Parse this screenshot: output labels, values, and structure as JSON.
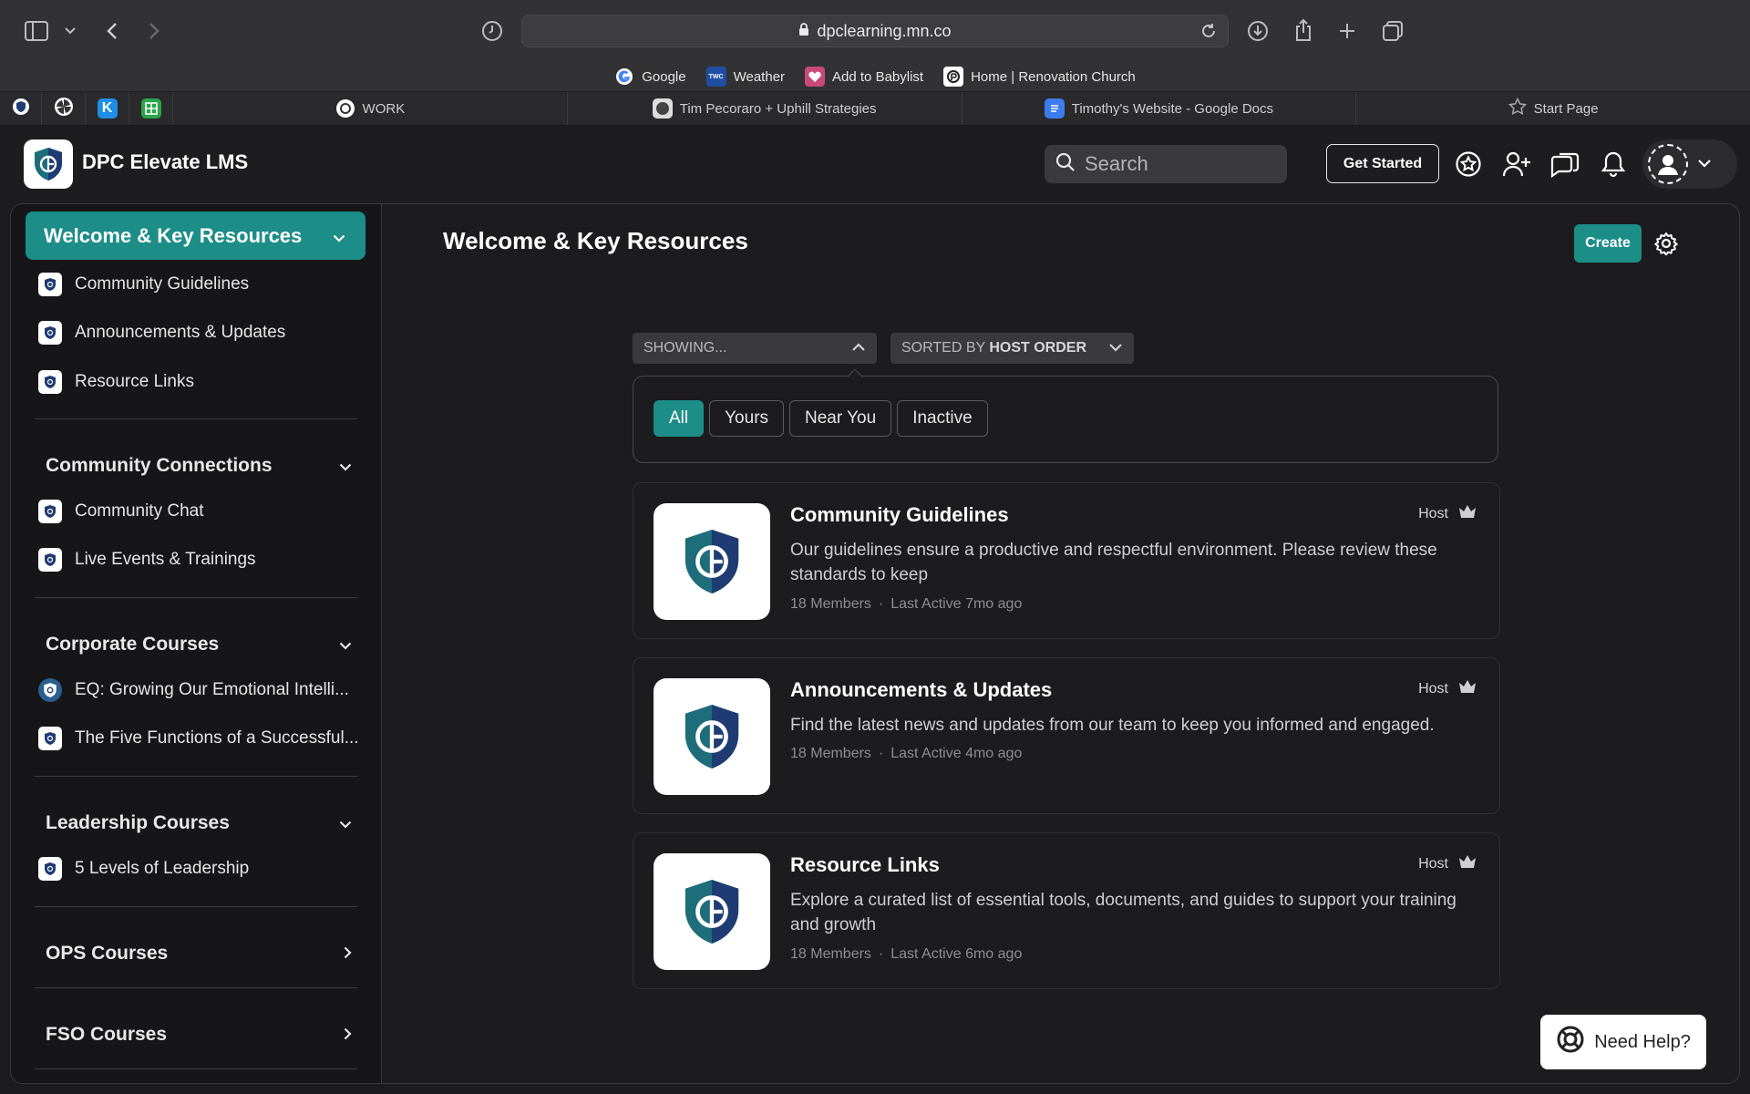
{
  "browser": {
    "url": "dpclearning.mn.co",
    "bookmarks": [
      {
        "label": "Google",
        "icon": "google-icon"
      },
      {
        "label": "Weather",
        "icon": "weather-channel-icon"
      },
      {
        "label": "Add to Babylist",
        "icon": "babylist-icon"
      },
      {
        "label": "Home | Renovation Church",
        "icon": "church-icon"
      }
    ],
    "tabs": [
      {
        "label": "WORK"
      },
      {
        "label": "Tim Pecoraro + Uphill Strategies"
      },
      {
        "label": "Timothy's Website - Google Docs"
      },
      {
        "label": "Start Page"
      }
    ]
  },
  "header": {
    "brand": "DPC Elevate LMS",
    "search_placeholder": "Search",
    "get_started": "Get Started"
  },
  "sidebar": {
    "active_section": "Welcome & Key Resources",
    "welcome_items": [
      "Community Guidelines",
      "Announcements & Updates",
      "Resource Links"
    ],
    "community_connections": {
      "title": "Community Connections",
      "items": [
        "Community Chat",
        "Live Events & Trainings"
      ]
    },
    "corporate_courses": {
      "title": "Corporate Courses",
      "items": [
        "EQ: Growing Our Emotional Intelli...",
        "The Five Functions of a Successful..."
      ]
    },
    "leadership_courses": {
      "title": "Leadership Courses",
      "items": [
        "5 Levels of Leadership"
      ]
    },
    "ops_courses": {
      "title": "OPS Courses"
    },
    "fso_courses": {
      "title": "FSO Courses"
    }
  },
  "main": {
    "title": "Welcome & Key Resources",
    "create": "Create",
    "showing": "SHOWING...",
    "sorted_prefix": "SORTED BY",
    "sorted_value": "HOST ORDER",
    "filters": [
      "All",
      "Yours",
      "Near You",
      "Inactive"
    ],
    "cards": [
      {
        "title": "Community Guidelines",
        "desc": "Our guidelines ensure a productive and respectful environment. Please review these standards to keep",
        "members": "18 Members",
        "sep": "·",
        "active": "Last Active 7mo ago",
        "role": "Host"
      },
      {
        "title": "Announcements & Updates",
        "desc": "Find the latest news and updates from our team to keep you informed and engaged.",
        "members": "18 Members",
        "sep": "·",
        "active": "Last Active 4mo ago",
        "role": "Host"
      },
      {
        "title": "Resource Links",
        "desc": "Explore a curated list of essential tools, documents, and guides to support your training and growth",
        "members": "18 Members",
        "sep": "·",
        "active": "Last Active 6mo ago",
        "role": "Host"
      }
    ],
    "need_help": "Need Help?"
  },
  "colors": {
    "accent": "#1d8d88",
    "shield_teal": "#1e6d7a",
    "shield_navy": "#1f3b73"
  }
}
